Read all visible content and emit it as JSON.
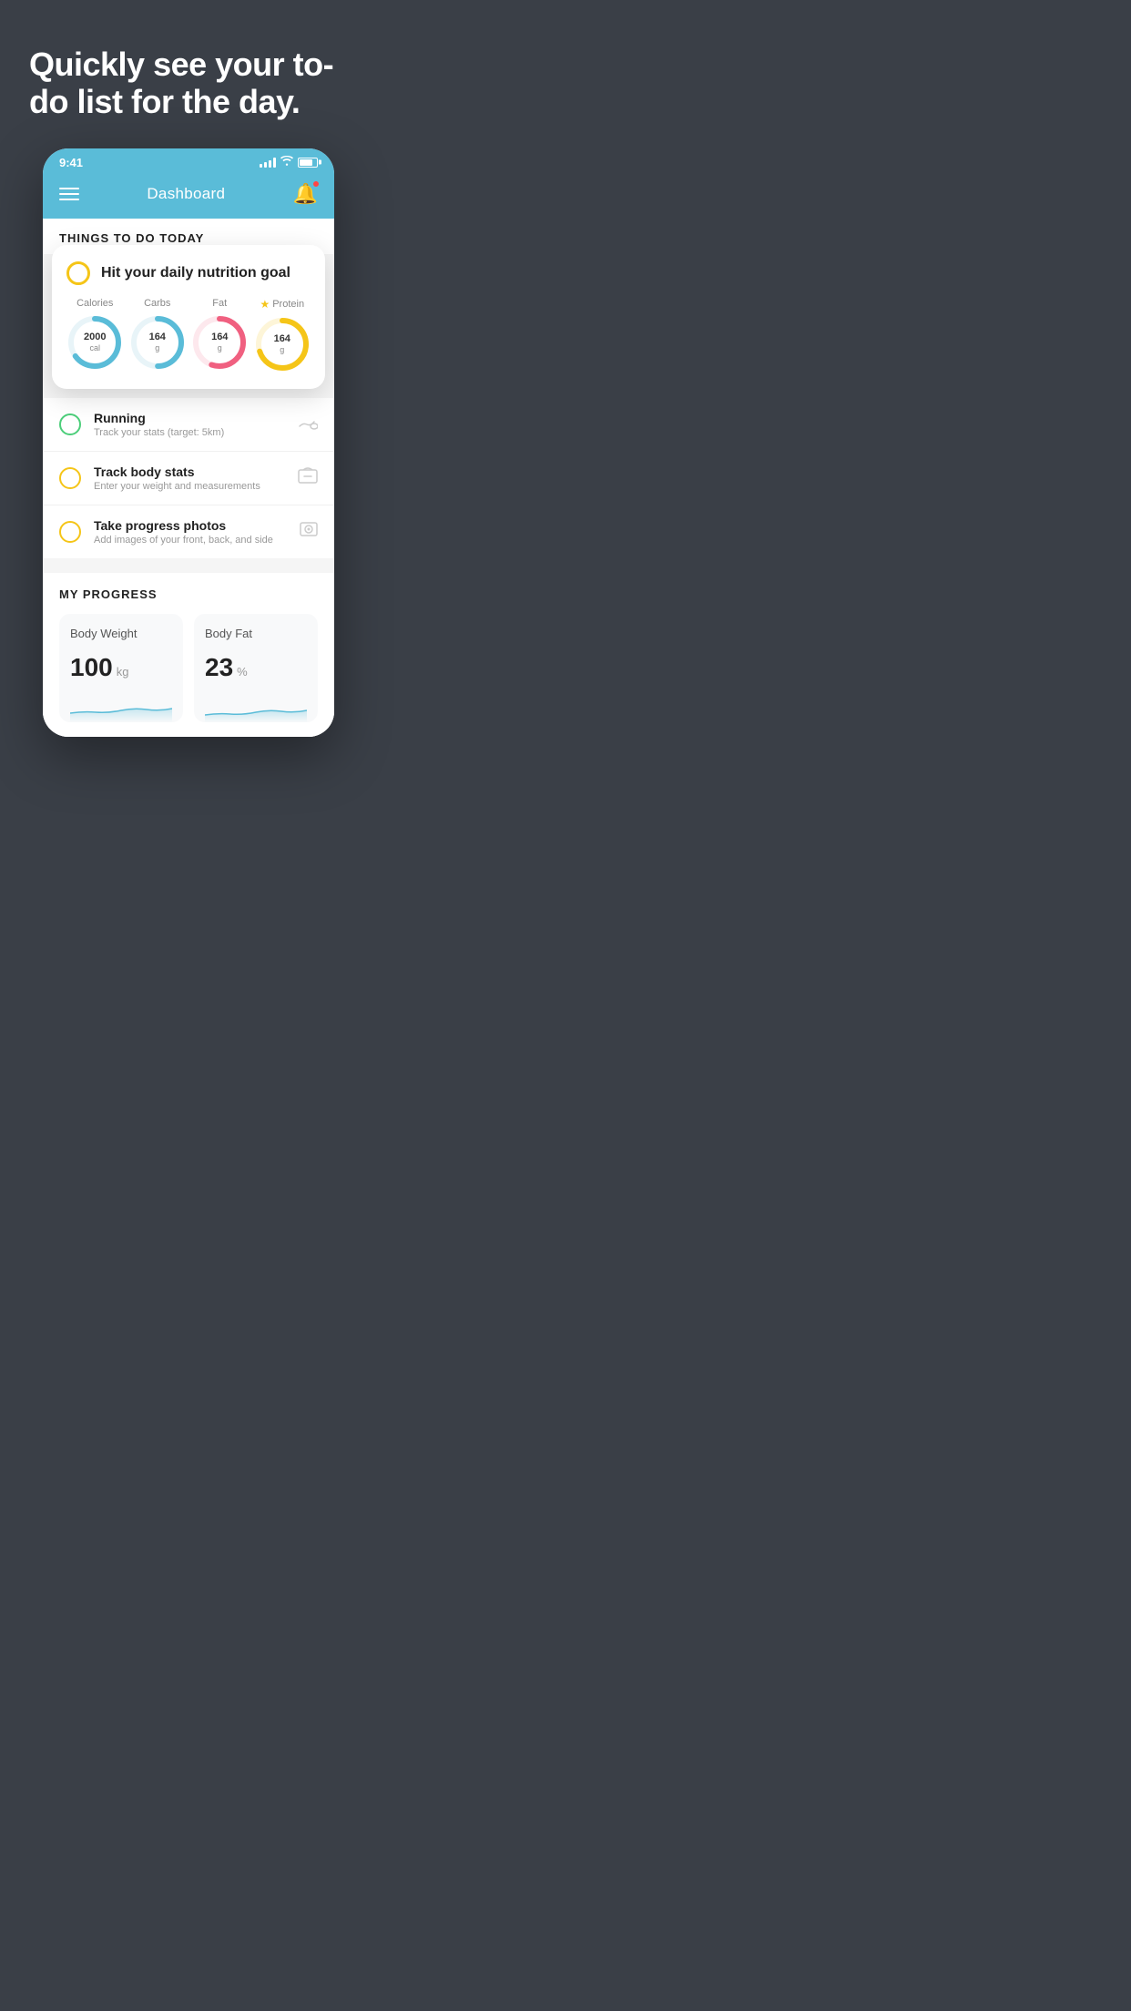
{
  "hero": {
    "title": "Quickly see your to-do list for the day."
  },
  "phone": {
    "status_bar": {
      "time": "9:41",
      "battery_level": 80
    },
    "nav": {
      "title": "Dashboard"
    },
    "things_to_do": {
      "section_label": "THINGS TO DO TODAY"
    },
    "nutrition_card": {
      "title": "Hit your daily nutrition goal",
      "items": [
        {
          "label": "Calories",
          "value": "2000",
          "unit": "cal",
          "color": "#5abcd8",
          "stroke_pct": 65
        },
        {
          "label": "Carbs",
          "value": "164",
          "unit": "g",
          "color": "#5abcd8",
          "stroke_pct": 50
        },
        {
          "label": "Fat",
          "value": "164",
          "unit": "g",
          "color": "#f06080",
          "stroke_pct": 55
        },
        {
          "label": "Protein",
          "value": "164",
          "unit": "g",
          "color": "#f5c518",
          "stroke_pct": 70,
          "starred": true
        }
      ]
    },
    "todo_items": [
      {
        "title": "Running",
        "subtitle": "Track your stats (target: 5km)",
        "circle_color": "green",
        "icon": "👟"
      },
      {
        "title": "Track body stats",
        "subtitle": "Enter your weight and measurements",
        "circle_color": "yellow",
        "icon": "⚖"
      },
      {
        "title": "Take progress photos",
        "subtitle": "Add images of your front, back, and side",
        "circle_color": "yellow",
        "icon": "🖼"
      }
    ],
    "progress": {
      "section_label": "MY PROGRESS",
      "cards": [
        {
          "title": "Body Weight",
          "value": "100",
          "unit": "kg"
        },
        {
          "title": "Body Fat",
          "value": "23",
          "unit": "%"
        }
      ]
    }
  }
}
